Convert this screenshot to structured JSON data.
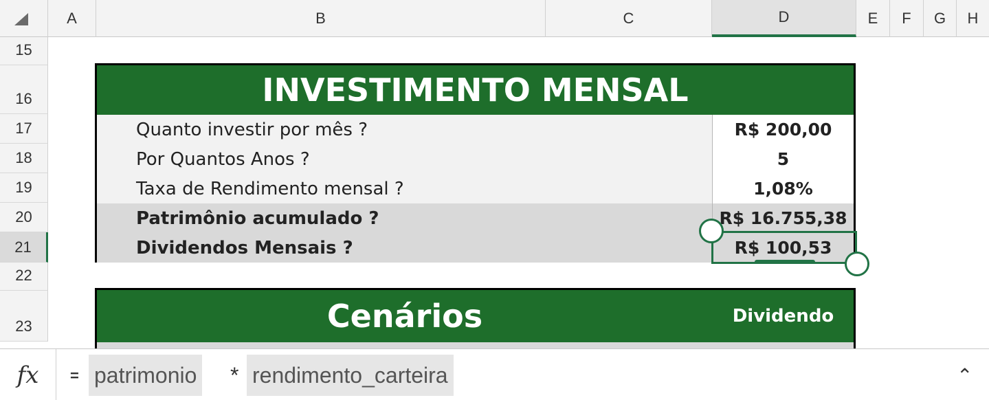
{
  "columns": [
    "A",
    "B",
    "C",
    "D",
    "E",
    "F",
    "G",
    "H"
  ],
  "rows": [
    "15",
    "16",
    "17",
    "18",
    "19",
    "20",
    "21",
    "22",
    "23"
  ],
  "table1": {
    "title": "INVESTIMENTO MENSAL",
    "rows": [
      {
        "label": "Quanto investir por mês ?",
        "value": "R$ 200,00"
      },
      {
        "label": "Por Quantos Anos ?",
        "value": "5"
      },
      {
        "label": "Taxa de Rendimento mensal ?",
        "value": "1,08%"
      },
      {
        "label": "Patrimônio acumulado ?",
        "value": "R$ 16.755,38"
      },
      {
        "label": "Dividendos Mensais ?",
        "value": "R$ 100,53"
      }
    ]
  },
  "table2": {
    "title": "Cenários",
    "column_label": "Dividendo"
  },
  "formula_bar": {
    "fx": "fx",
    "equals": "=",
    "token1": "patrimonio",
    "operator": "*",
    "token2": "rendimento_carteira",
    "expand_icon": "chevron-up-icon"
  },
  "selection": {
    "column": "D",
    "row": "21"
  },
  "colors": {
    "accent": "#217346",
    "header_green": "#1e6e2b"
  }
}
